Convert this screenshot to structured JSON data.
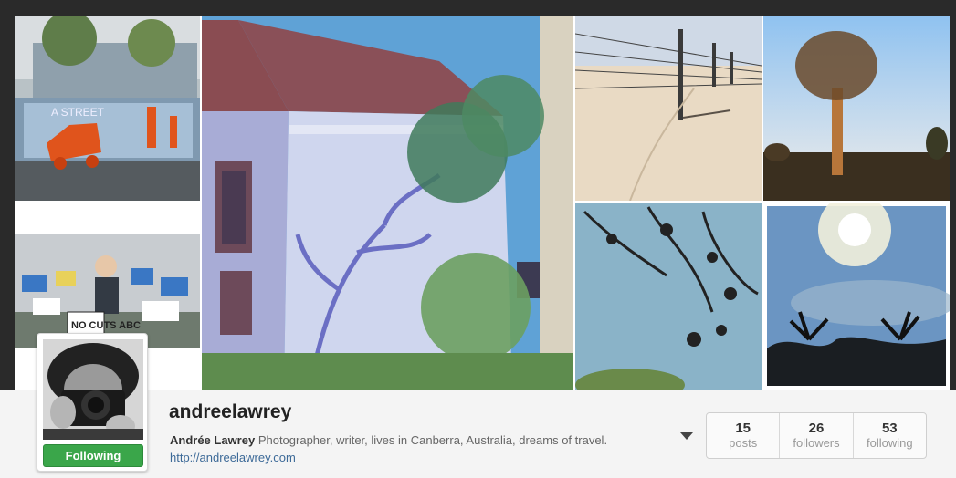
{
  "profile": {
    "username": "andreelawrey",
    "full_name": "Andrée Lawrey",
    "bio": " Photographer, writer, lives in Canberra, Australia, dreams of travel.",
    "website": "http://andreelawrey.com",
    "follow_button_label": "Following",
    "follow_button_color": "#3aa64a"
  },
  "stats": [
    {
      "value": "15",
      "label": "posts"
    },
    {
      "value": "26",
      "label": "followers"
    },
    {
      "value": "53",
      "label": "following"
    }
  ],
  "photos": [
    {
      "subject": "street scene with orange car sculpture",
      "sign_text": "A STREET"
    },
    {
      "subject": "protest crowd with signs",
      "sign_text": "NO CUTS ABC"
    },
    {
      "subject": "white house with tree shadow"
    },
    {
      "subject": "fence posts in desert sand"
    },
    {
      "subject": "quiver tree at sunset"
    },
    {
      "subject": "tree branches against blue sky"
    },
    {
      "subject": "sun over palm trees"
    }
  ],
  "icons": {
    "more_options": "chevron-down-icon"
  }
}
